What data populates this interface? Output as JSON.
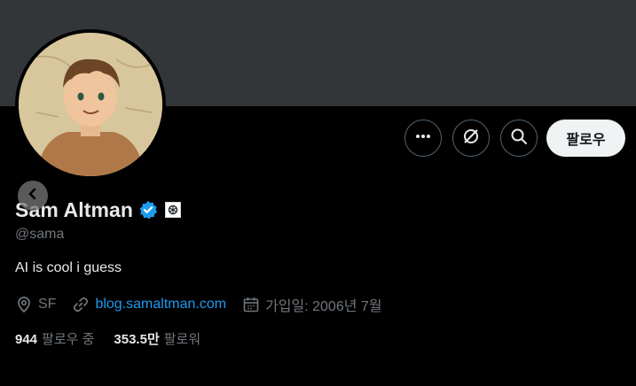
{
  "profile": {
    "display_name": "Sam Altman",
    "handle": "@sama",
    "bio": "AI is cool i guess",
    "location": "SF",
    "website": "blog.samaltman.com",
    "joined": "가입일: 2006년 7월",
    "following_count": "944",
    "following_label": "팔로우 중",
    "followers_count": "353.5만",
    "followers_label": "팔로워"
  },
  "actions": {
    "follow_label": "팔로우",
    "icons": [
      "more-icon",
      "grok-icon",
      "search-icon"
    ]
  },
  "colors": {
    "banner": "#333639",
    "background": "#000000",
    "verified": "#1d9bf0",
    "link": "#1d9bf0",
    "secondary_text": "#71767b"
  }
}
